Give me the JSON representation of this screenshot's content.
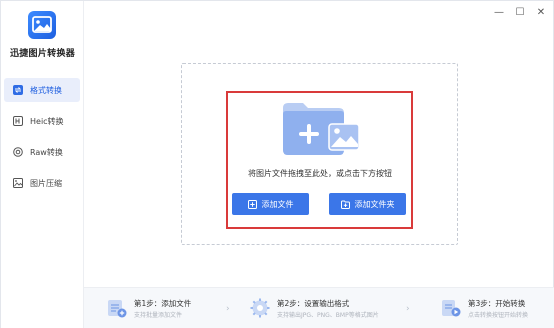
{
  "app": {
    "title": "迅捷图片转换器"
  },
  "window": {
    "minimize": "—",
    "maximize": "☐",
    "close": "✕"
  },
  "sidebar": {
    "items": [
      {
        "label": "格式转换",
        "icon": "format-convert-icon",
        "active": true
      },
      {
        "label": "Heic转换",
        "icon": "heic-icon",
        "active": false
      },
      {
        "label": "Raw转换",
        "icon": "raw-icon",
        "active": false
      },
      {
        "label": "图片压缩",
        "icon": "image-compress-icon",
        "active": false
      }
    ]
  },
  "main": {
    "drop_text": "将图片文件拖拽至此处，或点击下方按钮",
    "add_file_label": "添加文件",
    "add_folder_label": "添加文件夹"
  },
  "steps": [
    {
      "title": "第1步：添加文件",
      "desc": "支持批量添加文件"
    },
    {
      "title": "第2步：设置输出格式",
      "desc": "支持输出JPG、PNG、BMP等格式图片"
    },
    {
      "title": "第3步：开始转换",
      "desc": "点击转换按钮开始转换"
    }
  ],
  "colors": {
    "accent": "#3b76e8",
    "highlight": "#d93a3a",
    "active_bg": "#e9eefb"
  }
}
